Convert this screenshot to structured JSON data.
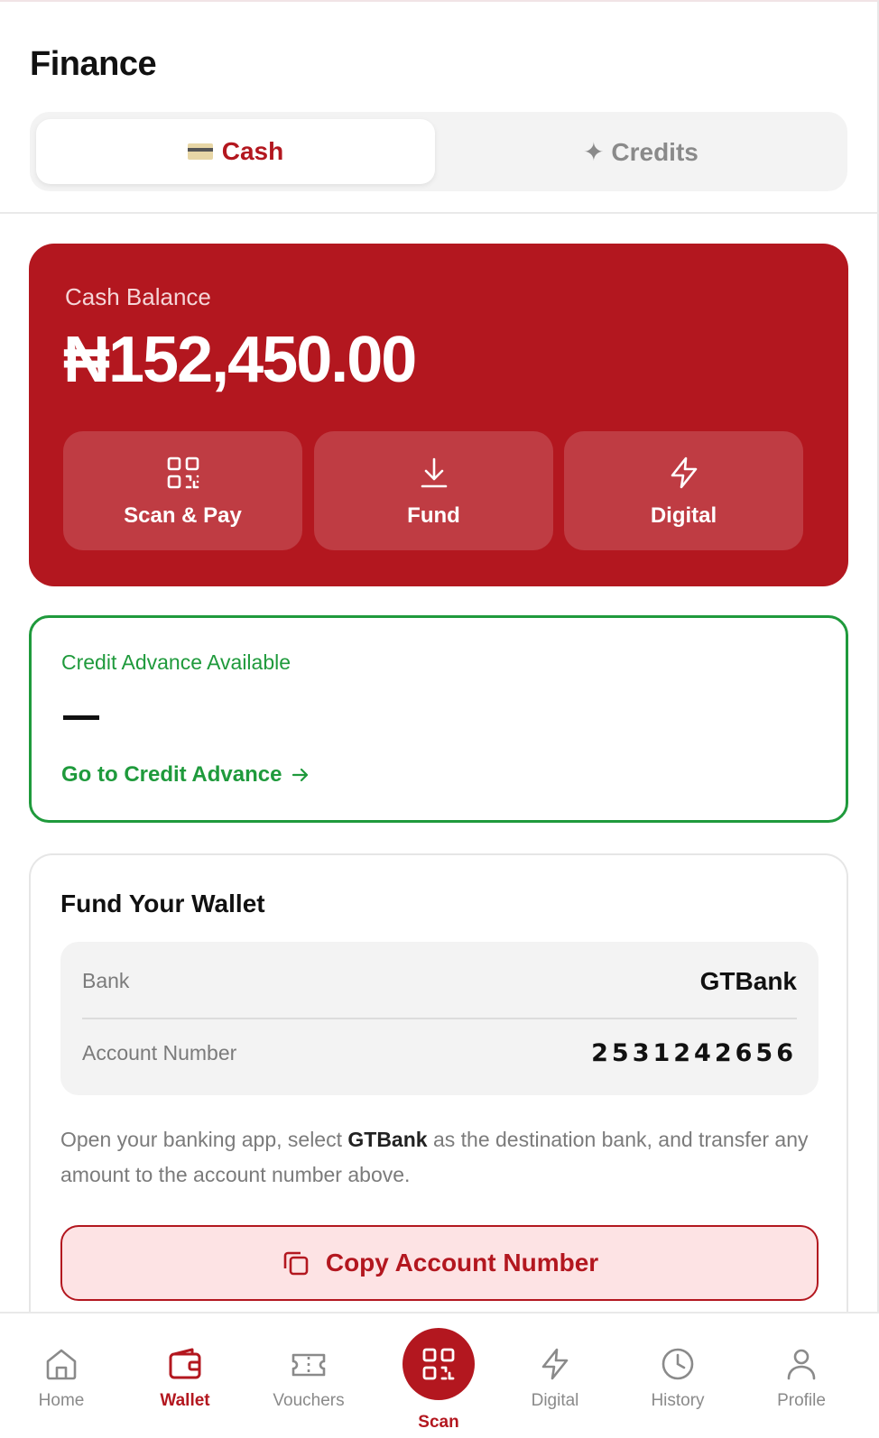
{
  "header": {
    "title": "Finance"
  },
  "segmented": {
    "cash_label": "Cash",
    "credits_label": "✦ Credits"
  },
  "balance": {
    "label": "Cash Balance",
    "value": "₦152,450.00",
    "actions": [
      {
        "label": "Scan & Pay",
        "icon": "qr-code-icon"
      },
      {
        "label": "Fund",
        "icon": "download-icon"
      },
      {
        "label": "Digital",
        "icon": "lightning-icon"
      }
    ]
  },
  "credit_advance": {
    "label": "Credit Advance Available",
    "value": "—",
    "link": "Go to Credit Advance"
  },
  "fund_wallet": {
    "title": "Fund Your Wallet",
    "bank_label": "Bank",
    "bank_value": "GTBank",
    "account_label": "Account Number",
    "account_value": "2531242656",
    "instruction_pre": "Open your banking app, select ",
    "instruction_bank": "GTBank",
    "instruction_post": " as the destination bank, and transfer any amount to the account number above.",
    "copy_button": "Copy Account Number"
  },
  "tabbar": {
    "items": [
      {
        "label": "Home",
        "icon": "home-icon"
      },
      {
        "label": "Wallet",
        "icon": "wallet-icon",
        "active": true
      },
      {
        "label": "Vouchers",
        "icon": "ticket-icon"
      },
      {
        "label": "Scan",
        "icon": "qr-code-icon"
      },
      {
        "label": "Digital",
        "icon": "lightning-icon"
      },
      {
        "label": "History",
        "icon": "clock-icon"
      },
      {
        "label": "Profile",
        "icon": "user-icon"
      }
    ]
  },
  "colors": {
    "brand_red": "#b3171f",
    "success_green": "#1f9a3c",
    "copy_button_bg": "#fde3e4"
  }
}
